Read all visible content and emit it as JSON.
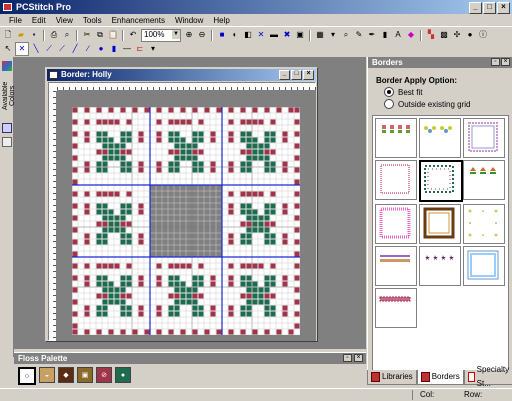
{
  "app": {
    "title": "PCStitch Pro"
  },
  "menu": [
    "File",
    "Edit",
    "View",
    "Tools",
    "Enhancements",
    "Window",
    "Help"
  ],
  "toolbar": {
    "zoom": "100%"
  },
  "left_strip": {
    "vertical_tab": "Available Colors"
  },
  "child_window": {
    "title": "Border: Holly"
  },
  "borders_panel": {
    "title": "Borders",
    "apply_option_label": "Border Apply Option:",
    "options": [
      "Best fit",
      "Outside existing grid"
    ],
    "selected_option": "Best fit"
  },
  "floss_palette": {
    "title": "Floss Palette"
  },
  "bottom_tabs": [
    "Libraries",
    "Borders",
    "Specialty St..."
  ],
  "status": {
    "col_label": "Col:",
    "row_label": "Row:"
  },
  "colors": {
    "stitch_green": "#1e6b50",
    "stitch_red": "#a0344a",
    "grid_line": "#1b2bd1",
    "window_title": "#0a246a"
  }
}
